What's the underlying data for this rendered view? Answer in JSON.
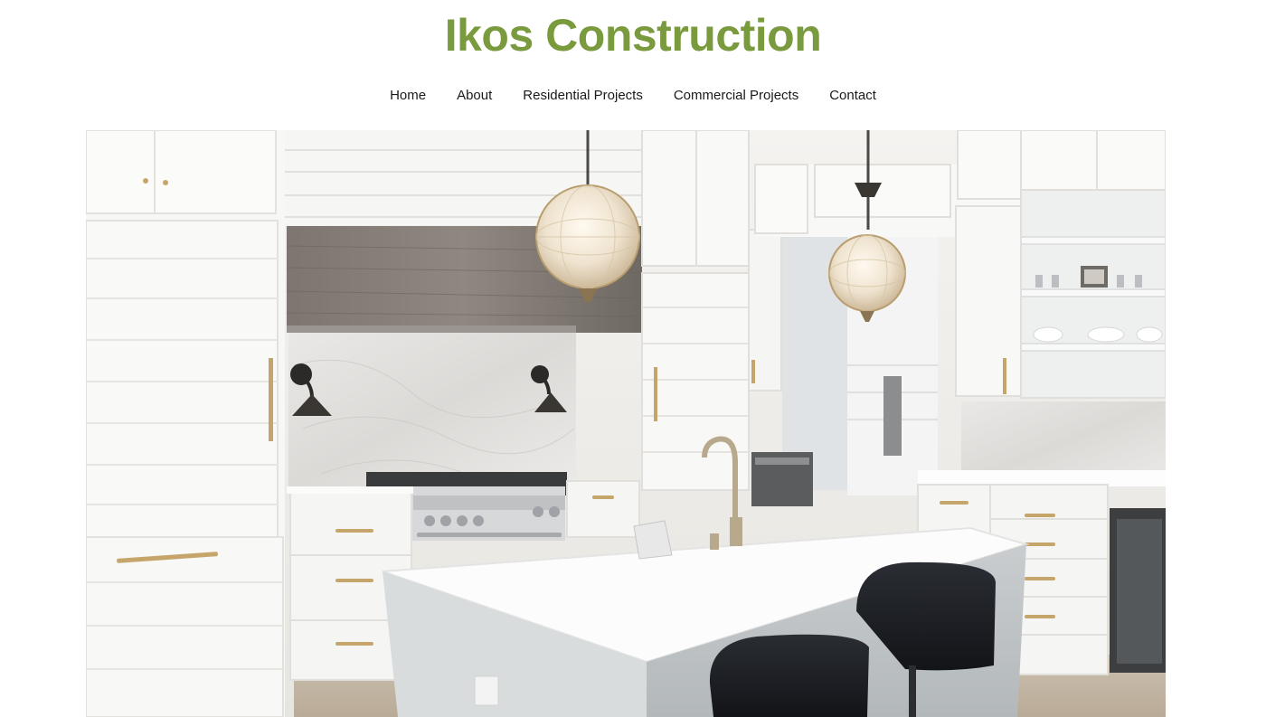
{
  "site": {
    "title": "Ikos Construction",
    "brand_color": "#7a9a3e"
  },
  "nav": {
    "items": [
      {
        "label": "Home"
      },
      {
        "label": "About"
      },
      {
        "label": "Residential Projects"
      },
      {
        "label": "Commercial Projects"
      },
      {
        "label": "Contact"
      }
    ]
  },
  "hero": {
    "image_subject": "white-kitchen-photo"
  }
}
